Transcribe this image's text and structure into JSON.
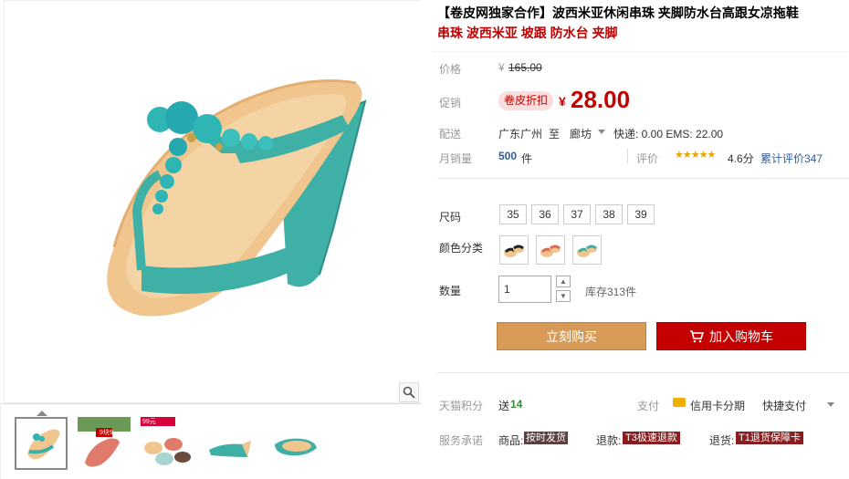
{
  "product": {
    "title": "【卷皮网独家合作】波西米亚休闲串珠 夹脚防水台高跟女凉拖鞋",
    "subtitle": "串珠 波西米亚 坡跟 防水台 夹脚"
  },
  "price": {
    "label": "价格",
    "currency": "¥",
    "original": "165.00",
    "promo_label": "促销",
    "promo_badge": "卷皮折扣",
    "promo_currency": "¥",
    "promo_value": "28.00"
  },
  "shipping": {
    "label": "配送",
    "from": "广东广州",
    "to_word": "至",
    "to": "廊坊",
    "fees": "快递: 0.00 EMS: 22.00"
  },
  "sales": {
    "label": "月销量",
    "count": "500",
    "unit": "件",
    "rating_label": "评价",
    "rating_score": "4.6分",
    "reviews": "累计评价347",
    "stars": 4.6
  },
  "options": {
    "size_label": "尺码",
    "sizes": [
      "35",
      "36",
      "37",
      "38",
      "39"
    ],
    "color_label": "颜色分类",
    "colors": [
      "black-sandal",
      "coral-sandal",
      "teal-sandal"
    ],
    "qty_label": "数量",
    "qty_value": "1",
    "stock": "库存313件"
  },
  "actions": {
    "buy": "立刻购买",
    "cart": "加入购物车"
  },
  "bottom": {
    "points_label": "天猫积分",
    "points_prefix": "送",
    "points_value": "14",
    "pay_label": "支付",
    "pay_card": "信用卡分期",
    "pay_quick": "快捷支付",
    "promise_label": "服务承诺",
    "promise_1_prefix": "商品:",
    "promise_1_tag": "按时发货",
    "promise_2_prefix": "退款:",
    "promise_2_tag": "T3极速退款",
    "promise_3_prefix": "退货:",
    "promise_3_tag": "T1退货保障卡"
  },
  "thumbs": {
    "badge_2": "9块9",
    "badge_3": "99元"
  },
  "colors": {
    "accent_red": "#c40000",
    "buy_brown": "#d79a57",
    "teal": "#3fb0a5",
    "sole": "#f0c68e"
  }
}
